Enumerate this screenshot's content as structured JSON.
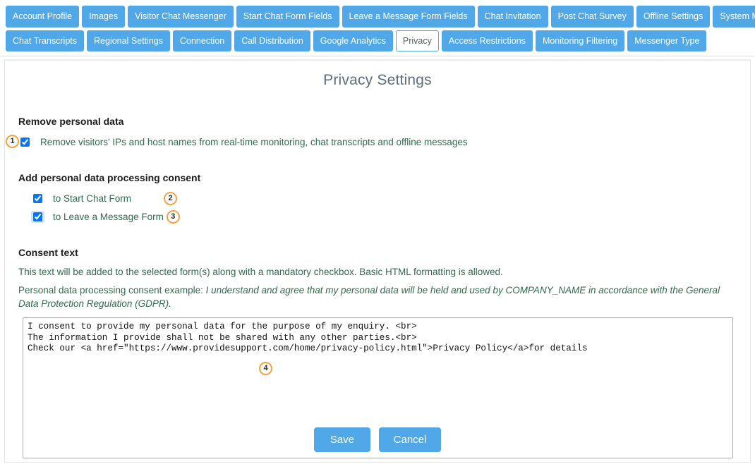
{
  "tabs": {
    "row1": [
      {
        "label": "Account Profile",
        "active": false
      },
      {
        "label": "Images",
        "active": false
      },
      {
        "label": "Visitor Chat Messenger",
        "active": false
      },
      {
        "label": "Start Chat Form Fields",
        "active": false
      },
      {
        "label": "Leave a Message Form Fields",
        "active": false
      },
      {
        "label": "Chat Invitation",
        "active": false
      },
      {
        "label": "Post Chat Survey",
        "active": false
      },
      {
        "label": "Offline Settings",
        "active": false
      },
      {
        "label": "System Messages",
        "active": false
      }
    ],
    "row2": [
      {
        "label": "Chat Transcripts",
        "active": false
      },
      {
        "label": "Regional Settings",
        "active": false
      },
      {
        "label": "Connection",
        "active": false
      },
      {
        "label": "Call Distribution",
        "active": false
      },
      {
        "label": "Google Analytics",
        "active": false
      },
      {
        "label": "Privacy",
        "active": true
      },
      {
        "label": "Access Restrictions",
        "active": false
      },
      {
        "label": "Monitoring Filtering",
        "active": false
      },
      {
        "label": "Messenger Type",
        "active": false
      }
    ]
  },
  "page": {
    "title": "Privacy Settings"
  },
  "remove_personal_data": {
    "heading": "Remove personal data",
    "checkbox_label": "Remove visitors' IPs and host names from real-time monitoring, chat transcripts and offline messages",
    "checked": true,
    "badge": "1"
  },
  "consent_toggles": {
    "heading": "Add personal data processing consent",
    "items": [
      {
        "label": "to Start Chat Form",
        "checked": true,
        "badge": "2",
        "focused": false
      },
      {
        "label": "to Leave a Message Form",
        "checked": true,
        "badge": "3",
        "focused": true
      }
    ]
  },
  "consent_text": {
    "heading": "Consent text",
    "description": "This text will be added to the selected form(s) along with a mandatory checkbox. Basic HTML formatting is allowed.",
    "example_prefix": "Personal data processing consent example: ",
    "example_italic": "I understand and agree that my personal data will be held and used by COMPANY_NAME in accordance with the General Data Protection Regulation (GDPR).",
    "textarea_value": "I consent to provide my personal data for the purpose of my enquiry. <br>\nThe information I provide shall not be shared with any other parties.<br>\nCheck our <a href=\"https://www.providesupport.com/home/privacy-policy.html\">Privacy Policy</a>for details",
    "badge": "4"
  },
  "footer": {
    "save_label": "Save",
    "cancel_label": "Cancel"
  },
  "colors": {
    "tab_blue": "#51a8e8",
    "body_green": "#2f6b4e",
    "badge_orange": "#f5a341",
    "title_gray": "#5d6b7a"
  }
}
